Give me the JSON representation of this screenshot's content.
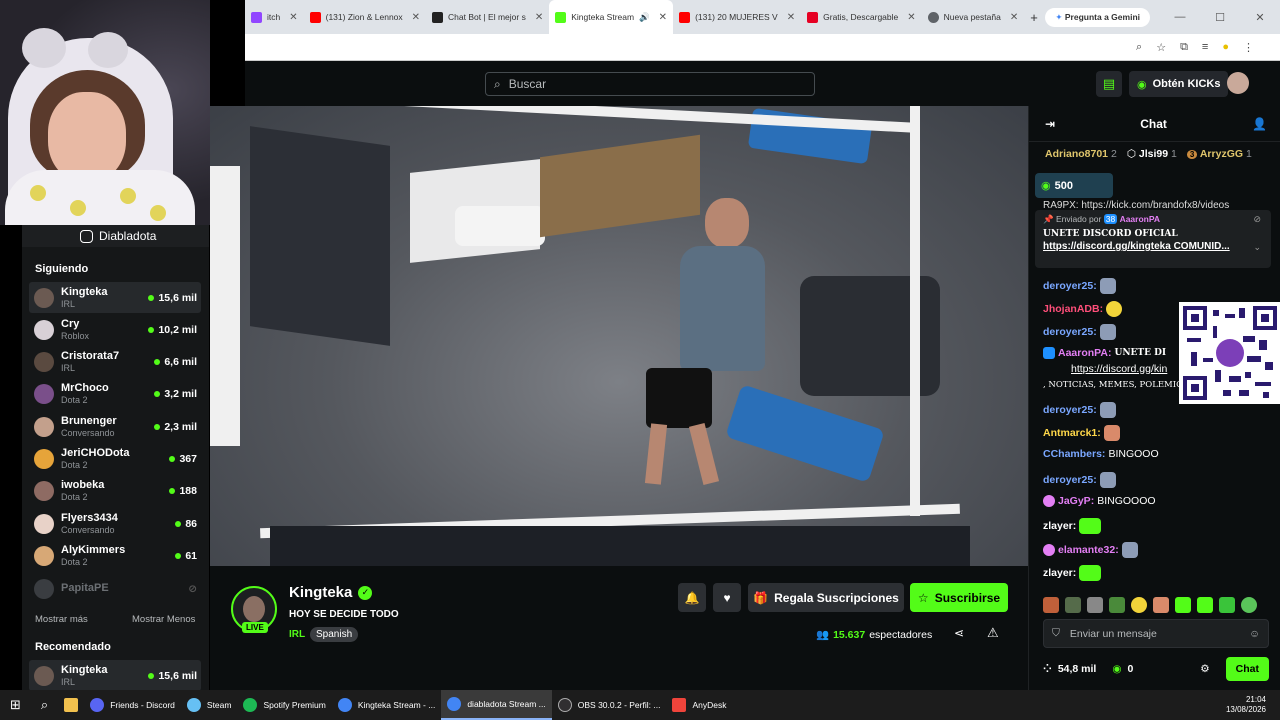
{
  "browser": {
    "tabs": [
      {
        "label": "itch",
        "color": "#9146ff"
      },
      {
        "label": "(131) Zion & Lennox",
        "color": "#ff0000"
      },
      {
        "label": "Chat Bot | El mejor s",
        "color": "#222222"
      },
      {
        "label": "Kingteka Stream",
        "color": "#53fc18",
        "active": true
      },
      {
        "label": "(131) 20 MUJERES V",
        "color": "#ff0000"
      },
      {
        "label": "Gratis, Descargable",
        "color": "#e60023"
      },
      {
        "label": "Nueva pestaña",
        "color": "#5f6368"
      }
    ],
    "new_tab": "+",
    "gemini": "Pregunta a Gemini"
  },
  "header": {
    "search_placeholder": "Buscar",
    "kicks_label": "Obtén KICKs"
  },
  "webcam": {
    "social_handle": "Diabladota"
  },
  "sidebar": {
    "following_title": "Siguiendo",
    "following": [
      {
        "name": "Kingteka",
        "category": "IRL",
        "viewers": "15,6 mil",
        "color": "#6b5a52"
      },
      {
        "name": "Cry",
        "category": "Roblox",
        "viewers": "10,2 mil",
        "color": "#d8d0d6"
      },
      {
        "name": "Cristorata7",
        "category": "IRL",
        "viewers": "6,6 mil",
        "color": "#5a4a40"
      },
      {
        "name": "MrChoco",
        "category": "Dota 2",
        "viewers": "3,2 mil",
        "color": "#7a4f8a"
      },
      {
        "name": "Brunenger",
        "category": "Conversando",
        "viewers": "2,3 mil",
        "color": "#c3a08c"
      },
      {
        "name": "JeriCHODota",
        "category": "Dota 2",
        "viewers": "367",
        "color": "#e6a43a"
      },
      {
        "name": "iwobeka",
        "category": "Dota 2",
        "viewers": "188",
        "color": "#8e6b63"
      },
      {
        "name": "Flyers3434",
        "category": "Conversando",
        "viewers": "86",
        "color": "#e8d2c8"
      },
      {
        "name": "AlyKimmers",
        "category": "Dota 2",
        "viewers": "61",
        "color": "#d7a876"
      }
    ],
    "offline": {
      "name": "PapitaPE"
    },
    "show_more": "Mostrar más",
    "show_less": "Mostrar Menos",
    "recommended_title": "Recomendado",
    "recommended": [
      {
        "name": "Kingteka",
        "category": "IRL",
        "viewers": "15,6 mil",
        "color": "#6b5a52"
      }
    ]
  },
  "stream": {
    "live_badge": "LIVE",
    "streamer": "Kingteka",
    "title": "HOY SE DECIDE TODO",
    "category": "IRL",
    "language": "Spanish",
    "gift_label": "Regala Suscripciones",
    "subscribe_label": "Suscribirse",
    "viewers_count": "15.637",
    "viewers_label": "espectadores"
  },
  "chat": {
    "title": "Chat",
    "gifters": [
      {
        "rank": "",
        "name": "Adriano8701",
        "count": "2"
      },
      {
        "rank": "",
        "name": "Jlsi99",
        "count": "1"
      },
      {
        "rank": "3",
        "name": "ArryzGG",
        "count": "1"
      }
    ],
    "kicks_counter": "500",
    "top_cut": "RA9PX: https://kick.com/brandofx8/videos",
    "pinned": {
      "sent_by": "Enviado por",
      "badge": "38",
      "user": "AaaronPA",
      "message": "UNETE DISCORD OFICIAL",
      "link": "https://discord.gg/kingteka COMUNID..."
    },
    "messages": [
      {
        "user": "deroyer25:",
        "color": "#7aa7ff",
        "text": "",
        "y": 0
      },
      {
        "user": "JhojanADB:",
        "color": "#ff4f7a",
        "text": ""
      },
      {
        "user": "deroyer25:",
        "color": "#7aa7ff",
        "text": ""
      },
      {
        "user": "AaaronPA:",
        "color": "#e37ff4",
        "text": "UNETE DI"
      },
      {
        "user": "",
        "color": "#ffffff",
        "text": "https://discord.gg/kin"
      },
      {
        "user": "",
        "color": "#ffffff",
        "text": ", NOTICIAS, MEMES, POLEMIC"
      },
      {
        "user": "deroyer25:",
        "color": "#7aa7ff",
        "text": ""
      },
      {
        "user": "Antmarck1:",
        "color": "#ffd84a",
        "text": ""
      },
      {
        "user": "CChambers:",
        "color": "#7aa7ff",
        "text": "BINGOOO"
      },
      {
        "user": "deroyer25:",
        "color": "#7aa7ff",
        "text": ""
      },
      {
        "user": "JaGyP:",
        "color": "#e37ff4",
        "text": "BINGOOOO"
      },
      {
        "user": "zlayer:",
        "color": "#ffffff",
        "text": ""
      },
      {
        "user": "elamante32:",
        "color": "#e37ff4",
        "text": ""
      },
      {
        "user": "zlayer:",
        "color": "#ffffff",
        "text": ""
      }
    ],
    "input_placeholder": "Enviar un mensaje",
    "points": "54,8 mil",
    "kicks_balance": "0",
    "send_label": "Chat"
  },
  "taskbar": {
    "items": [
      {
        "label": "Friends - Discord",
        "color": "#5865f2"
      },
      {
        "label": "Steam",
        "color": "#1b2838"
      },
      {
        "label": "Spotify Premium",
        "color": "#1db954"
      },
      {
        "label": "Kingteka Stream - ...",
        "color": "#4285f4"
      },
      {
        "label": "diabladota Stream ...",
        "color": "#4285f4",
        "active": true
      },
      {
        "label": "OBS 30.0.2 - Perfil: ...",
        "color": "#302e31"
      },
      {
        "label": "AnyDesk",
        "color": "#ef443b"
      }
    ],
    "time": "21:04",
    "date": "13/08/2026"
  }
}
